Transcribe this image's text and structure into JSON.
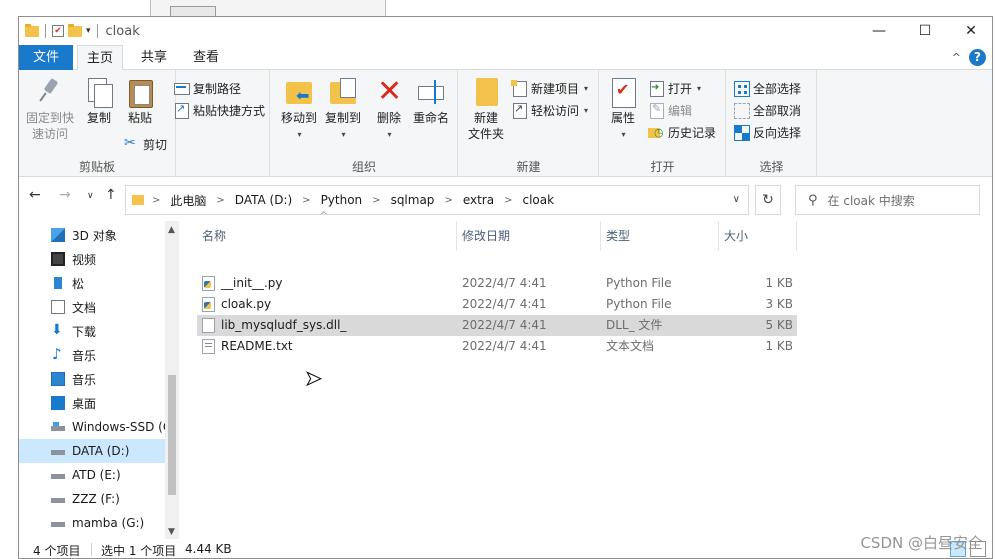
{
  "window": {
    "title": "cloak",
    "controls": {
      "minimize": "—",
      "maximize": "☐",
      "close": "✕"
    }
  },
  "ribbon": {
    "tabs": [
      {
        "label": "文件"
      },
      {
        "label": "主页"
      },
      {
        "label": "共享"
      },
      {
        "label": "查看"
      }
    ],
    "groups": {
      "clipboard": {
        "label": "剪贴板",
        "pin_label_1": "固定到快",
        "pin_label_2": "速访问",
        "copy_label": "复制",
        "paste_label": "粘贴",
        "copy_path_label": "复制路径",
        "paste_shortcut_label": "粘贴快捷方式",
        "cut_label": "剪切"
      },
      "organize": {
        "label": "组织",
        "move_to_label": "移动到",
        "copy_to_label": "复制到",
        "delete_label": "删除",
        "rename_label": "重命名"
      },
      "new": {
        "label": "新建",
        "new_folder_label_1": "新建",
        "new_folder_label_2": "文件夹",
        "new_item_label": "新建项目",
        "easy_access_label": "轻松访问"
      },
      "open": {
        "label": "打开",
        "properties_label": "属性",
        "open_label": "打开",
        "edit_label": "编辑",
        "history_label": "历史记录"
      },
      "select": {
        "label": "选择",
        "select_all_label": "全部选择",
        "select_none_label": "全部取消",
        "invert_label": "反向选择"
      }
    }
  },
  "address": {
    "crumbs": [
      "此电脑",
      "DATA (D:)",
      "Python",
      "sqlmap",
      "extra",
      "cloak"
    ]
  },
  "search": {
    "placeholder": "在 cloak 中搜索"
  },
  "nav_pane": {
    "items": [
      {
        "label": "3D 对象",
        "icon": "3d-objects-icon"
      },
      {
        "label": "视频",
        "icon": "video-icon"
      },
      {
        "label": "松",
        "icon": "image-icon"
      },
      {
        "label": "文档",
        "icon": "document-icon"
      },
      {
        "label": "下载",
        "icon": "download-icon"
      },
      {
        "label": "音乐",
        "icon": "music-icon"
      },
      {
        "label": "音乐",
        "icon": "picture-icon"
      },
      {
        "label": "桌面",
        "icon": "desktop-icon"
      },
      {
        "label": "Windows-SSD (C:)",
        "icon": "drive-icon"
      },
      {
        "label": "DATA (D:)",
        "icon": "drive-icon",
        "selected": true
      },
      {
        "label": "ATD (E:)",
        "icon": "drive-icon"
      },
      {
        "label": "ZZZ (F:)",
        "icon": "drive-icon"
      },
      {
        "label": "mamba (G:)",
        "icon": "drive-icon"
      }
    ]
  },
  "file_list": {
    "columns": [
      "名称",
      "修改日期",
      "类型",
      "大小"
    ],
    "rows": [
      {
        "name": "__init__.py",
        "date": "2022/4/7 4:41",
        "type": "Python File",
        "size": "1 KB",
        "icon": "python-file-icon"
      },
      {
        "name": "cloak.py",
        "date": "2022/4/7 4:41",
        "type": "Python File",
        "size": "3 KB",
        "icon": "python-file-icon"
      },
      {
        "name": "lib_mysqludf_sys.dll_",
        "date": "2022/4/7 4:41",
        "type": "DLL_ 文件",
        "size": "5 KB",
        "icon": "file-icon",
        "selected": true
      },
      {
        "name": "README.txt",
        "date": "2022/4/7 4:41",
        "type": "文本文档",
        "size": "1 KB",
        "icon": "text-file-icon"
      }
    ]
  },
  "status": {
    "item_count": "4 个项目",
    "selection": "选中 1 个项目",
    "selection_size": "4.44 KB"
  },
  "watermark": "CSDN @白昼安全",
  "colors": {
    "accent": "#1979ca",
    "selection": "#cce8ff",
    "row_selected": "#d9d9d9",
    "folder": "#f3c24b"
  }
}
